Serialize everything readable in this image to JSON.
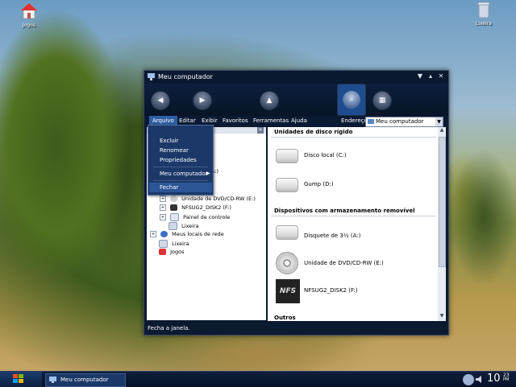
{
  "desktop": {
    "icons": [
      {
        "label": "Jogos",
        "icon": "games-icon"
      },
      {
        "label": "Lixeira",
        "icon": "recycle-bin-icon"
      }
    ]
  },
  "window": {
    "title": "Meu computador",
    "controls": [
      "▼",
      "✕"
    ],
    "menubar": [
      "Arquivo",
      "Editar",
      "Exibir",
      "Favoritos",
      "Ferramentas",
      "Ajuda"
    ],
    "address": {
      "label": "Endereço",
      "value": "Meu computador"
    },
    "tree": [
      {
        "label": "Unidade de DVD/CD-RW (E:)",
        "expander": "+",
        "icon": "dvd-drive-icon"
      },
      {
        "label": "NFSUG2_DISK2 (F:)",
        "expander": "+",
        "icon": "nfs-disc-icon"
      },
      {
        "label": "Painel de controle",
        "expander": "+",
        "icon": "control-panel-icon"
      },
      {
        "label": "Lixeira",
        "expander": "",
        "icon": "recycle-bin-icon"
      },
      {
        "label": "Meus locais de rede",
        "expander": "+",
        "icon": "network-icon"
      },
      {
        "label": "Lixeira",
        "expander": "",
        "icon": "recycle-bin-icon"
      },
      {
        "label": "Jogos",
        "expander": "",
        "icon": "games-icon"
      }
    ],
    "tree_partial": "s (A:)",
    "groups": [
      {
        "title": "Unidades de disco rígido",
        "drives": [
          "Disco local (C:)",
          "Gump (D:)"
        ]
      },
      {
        "title": "Dispositivos com armazenamento removível",
        "drives": [
          "Disquete de 3½ (A:)",
          "Unidade de DVD/CD-RW (E:)",
          "NFSUG2_DISK2 (F:)"
        ]
      },
      {
        "title": "Outros",
        "drives": []
      }
    ],
    "nfs_logo_text": "NFS",
    "status": "Fecha a janela."
  },
  "context_menu": {
    "items": [
      "Excluir",
      "Renomear",
      "Propriedades",
      "Meu computador",
      "Fechar"
    ],
    "submenu_arrow": "▶",
    "highlighted": "Fechar"
  },
  "taskbar": {
    "task_label": "Meu computador",
    "clock": {
      "hour": "10",
      "minute": "23",
      "ampm": "PM"
    }
  },
  "colors": {
    "window_bg": "#0b1930",
    "menu_highlight": "#2f5fa3",
    "context_bg": "#1b3868"
  }
}
